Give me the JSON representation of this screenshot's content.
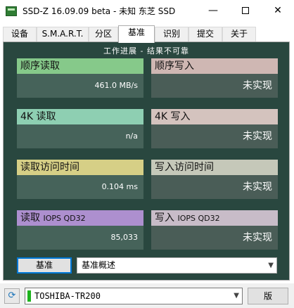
{
  "window": {
    "title": "SSD-Z 16.09.09 beta - 未知 东芝 SSD",
    "minimize_glyph": "—",
    "close_glyph": "✕"
  },
  "tabs": [
    {
      "label": "设备",
      "active": false
    },
    {
      "label": "S.M.A.R.T.",
      "active": false
    },
    {
      "label": "分区",
      "active": false
    },
    {
      "label": "基准",
      "active": true
    },
    {
      "label": "识别",
      "active": false
    },
    {
      "label": "提交",
      "active": false
    },
    {
      "label": "关于",
      "active": false
    }
  ],
  "benchmark": {
    "header": "工作进展 - 结果不可靠",
    "seq_read": {
      "label": "顺序读取",
      "value": "461.0 MB/s"
    },
    "seq_write": {
      "label": "顺序写入",
      "value": "未实现"
    },
    "k4_read": {
      "label": "4K 读取",
      "value": "n/a"
    },
    "k4_write": {
      "label": "4K 写入",
      "value": "未实现"
    },
    "access_read": {
      "label": "读取访问时间",
      "value": "0.104 ms"
    },
    "access_write": {
      "label": "写入访问时间",
      "value": "未实现"
    },
    "iops_read": {
      "label_main": "读取",
      "label_sub": "IOPS QD32",
      "value": "85,033"
    },
    "iops_write": {
      "label_main": "写入",
      "label_sub": "IOPS QD32",
      "value": "未实现"
    }
  },
  "controls": {
    "bench_button": "基准",
    "mode_select": "基准概述"
  },
  "status": {
    "drive_name": "TOSHIBA-TR200",
    "side_button": "版"
  },
  "colors": {
    "panel_bg": "#29473f",
    "seq_read": "#86c98a",
    "k4_read": "#8ecfb2",
    "access_read": "#d6cf86",
    "iops_read": "#ad8fcf",
    "seq_write": "#cfb7b3",
    "k4_write": "#d4c3be",
    "access_write": "#c5c8b9",
    "iops_write": "#c8bcc8",
    "value_bg": "#46635a",
    "write_value_bg": "#4a5d57",
    "accent": "#0078d7"
  }
}
